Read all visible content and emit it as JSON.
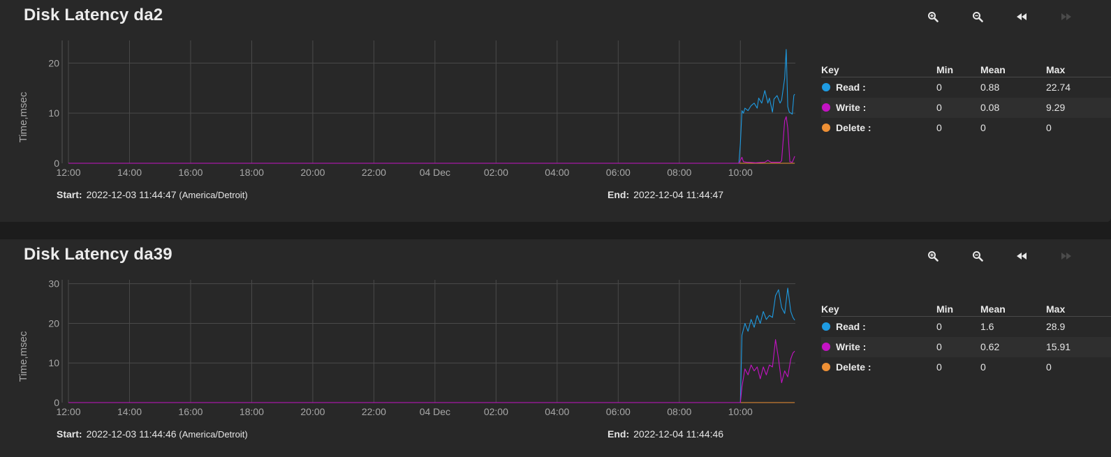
{
  "panels": [
    {
      "title": "Disk Latency da2",
      "ylabel": "Time,msec",
      "start_label": "Start:",
      "start_value": "2022-12-03 11:44:47",
      "timezone": "(America/Detroit)",
      "end_label": "End:",
      "end_value": "2022-12-04 11:44:47",
      "legend": {
        "headers": {
          "key": "Key",
          "min": "Min",
          "mean": "Mean",
          "max": "Max"
        },
        "rows": [
          {
            "name": "Read :",
            "min": "0",
            "mean": "0.88",
            "max": "22.74"
          },
          {
            "name": "Write :",
            "min": "0",
            "mean": "0.08",
            "max": "9.29"
          },
          {
            "name": "Delete :",
            "min": "0",
            "mean": "0",
            "max": "0"
          }
        ]
      }
    },
    {
      "title": "Disk Latency da39",
      "ylabel": "Time,msec",
      "start_label": "Start:",
      "start_value": "2022-12-03 11:44:46",
      "timezone": "(America/Detroit)",
      "end_label": "End:",
      "end_value": "2022-12-04 11:44:46",
      "legend": {
        "headers": {
          "key": "Key",
          "min": "Min",
          "mean": "Mean",
          "max": "Max"
        },
        "rows": [
          {
            "name": "Read :",
            "min": "0",
            "mean": "1.6",
            "max": "28.9"
          },
          {
            "name": "Write :",
            "min": "0",
            "mean": "0.62",
            "max": "15.91"
          },
          {
            "name": "Delete :",
            "min": "0",
            "mean": "0",
            "max": "0"
          }
        ]
      }
    }
  ],
  "toolbar": {
    "buttons": [
      {
        "name": "zoom-in-icon",
        "glyph": "🔍︎+",
        "enabled": true
      },
      {
        "name": "zoom-out-icon",
        "glyph": "🔍︎−",
        "enabled": true
      },
      {
        "name": "step-back-icon",
        "glyph": "◂◂",
        "enabled": true
      },
      {
        "name": "step-forward-icon",
        "glyph": "▸▸",
        "enabled": false
      }
    ]
  },
  "colors": {
    "read": "#1e9be2",
    "write": "#c413c4",
    "delete": "#ee9035",
    "grid": "#4a4a4a",
    "background": "#282828"
  },
  "chart_data": [
    {
      "type": "line",
      "x_unit": "hours since 2022-12-03 00:00",
      "x_tick_labels": [
        "12:00",
        "14:00",
        "16:00",
        "18:00",
        "20:00",
        "22:00",
        "04 Dec",
        "02:00",
        "04:00",
        "06:00",
        "08:00",
        "10:00"
      ],
      "x_tick_values": [
        12,
        14,
        16,
        18,
        20,
        22,
        24,
        26,
        28,
        30,
        32,
        34
      ],
      "xlim": [
        12,
        35.8
      ],
      "ylim": [
        0,
        24.5
      ],
      "y_ticks": [
        0,
        10,
        20
      ],
      "series": [
        {
          "name": "Read",
          "color": "#1e9be2",
          "x": [
            12,
            33.95,
            34.0,
            34.05,
            34.1,
            34.15,
            34.25,
            34.35,
            34.45,
            34.55,
            34.6,
            34.7,
            34.8,
            34.9,
            34.95,
            35.05,
            35.1,
            35.2,
            35.3,
            35.35,
            35.45,
            35.5,
            35.55,
            35.6,
            35.7,
            35.75,
            35.78
          ],
          "values": [
            0,
            0,
            4,
            10.5,
            10,
            11,
            10.5,
            11.5,
            12,
            11,
            13,
            12,
            14.5,
            12,
            13,
            10.2,
            12.8,
            13.5,
            12,
            12.6,
            17,
            22.7,
            11.3,
            10.2,
            9.8,
            13.5,
            13.8
          ]
        },
        {
          "name": "Write",
          "color": "#c413c4",
          "x": [
            12,
            33.95,
            34.05,
            34.1,
            34.2,
            34.5,
            34.8,
            34.9,
            35.0,
            35.2,
            35.3,
            35.35,
            35.45,
            35.5,
            35.55,
            35.62,
            35.7,
            35.78
          ],
          "values": [
            0,
            0,
            1.2,
            0.3,
            0.2,
            0.1,
            0.2,
            0.6,
            0.2,
            0.2,
            0.2,
            0.5,
            8.5,
            9.3,
            7,
            0.3,
            0.2,
            1.4
          ]
        },
        {
          "name": "Delete",
          "color": "#ee9035",
          "x": [
            12,
            35.78
          ],
          "values": [
            0,
            0
          ]
        }
      ]
    },
    {
      "type": "line",
      "x_unit": "hours since 2022-12-03 00:00",
      "x_tick_labels": [
        "12:00",
        "14:00",
        "16:00",
        "18:00",
        "20:00",
        "22:00",
        "04 Dec",
        "02:00",
        "04:00",
        "06:00",
        "08:00",
        "10:00"
      ],
      "x_tick_values": [
        12,
        14,
        16,
        18,
        20,
        22,
        24,
        26,
        28,
        30,
        32,
        34
      ],
      "xlim": [
        12,
        35.8
      ],
      "ylim": [
        0,
        31
      ],
      "y_ticks": [
        0,
        10,
        20,
        30
      ],
      "series": [
        {
          "name": "Read",
          "color": "#1e9be2",
          "x": [
            12,
            34.0,
            34.05,
            34.15,
            34.25,
            34.35,
            34.45,
            34.55,
            34.65,
            34.75,
            34.85,
            34.95,
            35.05,
            35.15,
            35.25,
            35.35,
            35.45,
            35.55,
            35.65,
            35.72,
            35.78
          ],
          "values": [
            0,
            0,
            17,
            20,
            18,
            21,
            19,
            22,
            20,
            23,
            21,
            22,
            21.5,
            27,
            28.5,
            24,
            22.5,
            28.9,
            23,
            21.5,
            20.8
          ]
        },
        {
          "name": "Write",
          "color": "#c413c4",
          "x": [
            12,
            34.0,
            34.05,
            34.15,
            34.25,
            34.35,
            34.45,
            34.55,
            34.65,
            34.75,
            34.85,
            34.95,
            35.05,
            35.15,
            35.25,
            35.35,
            35.45,
            35.55,
            35.65,
            35.72,
            35.78
          ],
          "values": [
            0,
            0,
            4,
            8.5,
            7,
            9.5,
            8,
            9,
            6,
            9,
            7,
            9.5,
            9,
            15.9,
            11,
            5,
            8,
            6.5,
            11,
            12.5,
            13
          ]
        },
        {
          "name": "Delete",
          "color": "#ee9035",
          "x": [
            12,
            35.78
          ],
          "values": [
            0,
            0
          ]
        }
      ]
    }
  ]
}
